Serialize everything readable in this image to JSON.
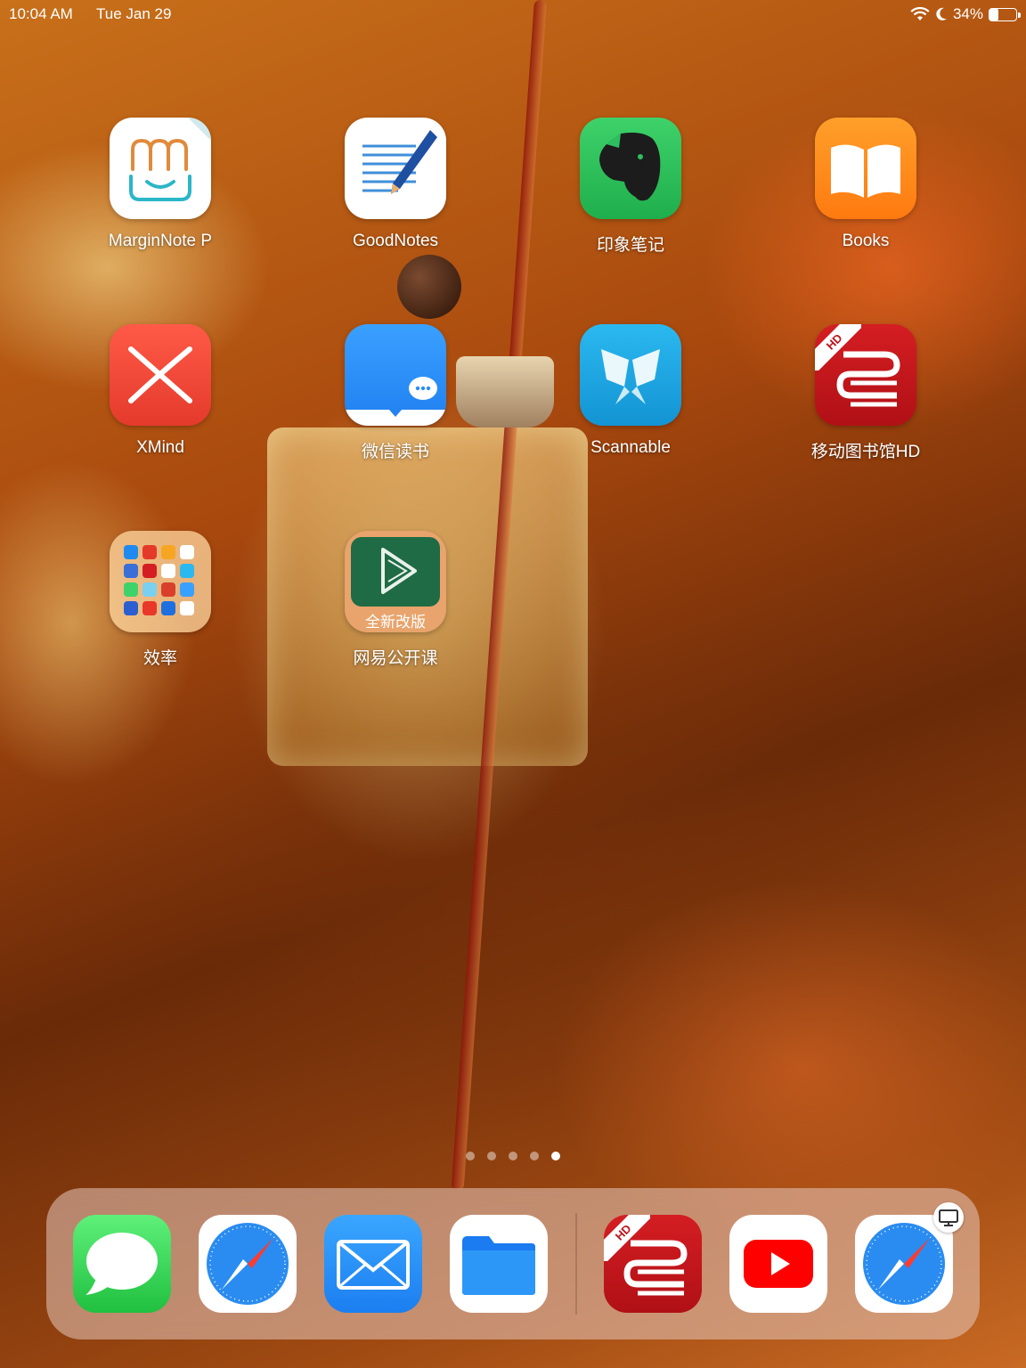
{
  "status_bar": {
    "time": "10:04 AM",
    "date": "Tue Jan 29",
    "battery_percent": "34%",
    "battery_level": 0.34,
    "icons": [
      "wifi-icon",
      "moon-icon",
      "battery-icon"
    ]
  },
  "apps": [
    {
      "id": "marginnote",
      "label": "MarginNote P",
      "icon": "marginnote-icon"
    },
    {
      "id": "goodnotes",
      "label": "GoodNotes",
      "icon": "goodnotes-icon"
    },
    {
      "id": "evernote",
      "label": "印象笔记",
      "icon": "evernote-icon"
    },
    {
      "id": "books",
      "label": "Books",
      "icon": "books-icon"
    },
    {
      "id": "xmind",
      "label": "XMind",
      "icon": "xmind-icon"
    },
    {
      "id": "weread",
      "label": "微信读书",
      "icon": "weread-icon"
    },
    {
      "id": "scannable",
      "label": "Scannable",
      "icon": "scannable-icon"
    },
    {
      "id": "mobile-library",
      "label": "移动图书馆HD",
      "icon": "mobile-library-icon",
      "badge": "HD"
    },
    {
      "id": "efficiency-folder",
      "label": "效率",
      "icon": "folder-icon"
    },
    {
      "id": "netease-open-course",
      "label": "网易公开课",
      "icon": "netease-open-course-icon",
      "icon_text": "全新改版"
    }
  ],
  "page_dots": {
    "count": 5,
    "active_index": 4
  },
  "dock": [
    {
      "id": "messages",
      "icon": "messages-icon"
    },
    {
      "id": "safari",
      "icon": "safari-icon"
    },
    {
      "id": "mail",
      "icon": "mail-icon"
    },
    {
      "id": "files",
      "icon": "files-icon"
    },
    {
      "id": "mobile-library-dock",
      "icon": "mobile-library-icon",
      "badge": "HD"
    },
    {
      "id": "youtube",
      "icon": "youtube-icon"
    },
    {
      "id": "safari-handoff",
      "icon": "safari-icon",
      "handoff_icon": "desktop-icon"
    }
  ],
  "colors": {
    "evernote_green": "#2dbe60",
    "books_orange": "#ff8a1c",
    "xmind_red": "#f04a3a",
    "weread_blue": "#2b8cf6",
    "scannable_blue": "#1aa5e6",
    "library_red": "#c0151b",
    "messages_green": "#3ddc5a",
    "mail_blue": "#1f8af0",
    "youtube_red": "#ff0000"
  }
}
